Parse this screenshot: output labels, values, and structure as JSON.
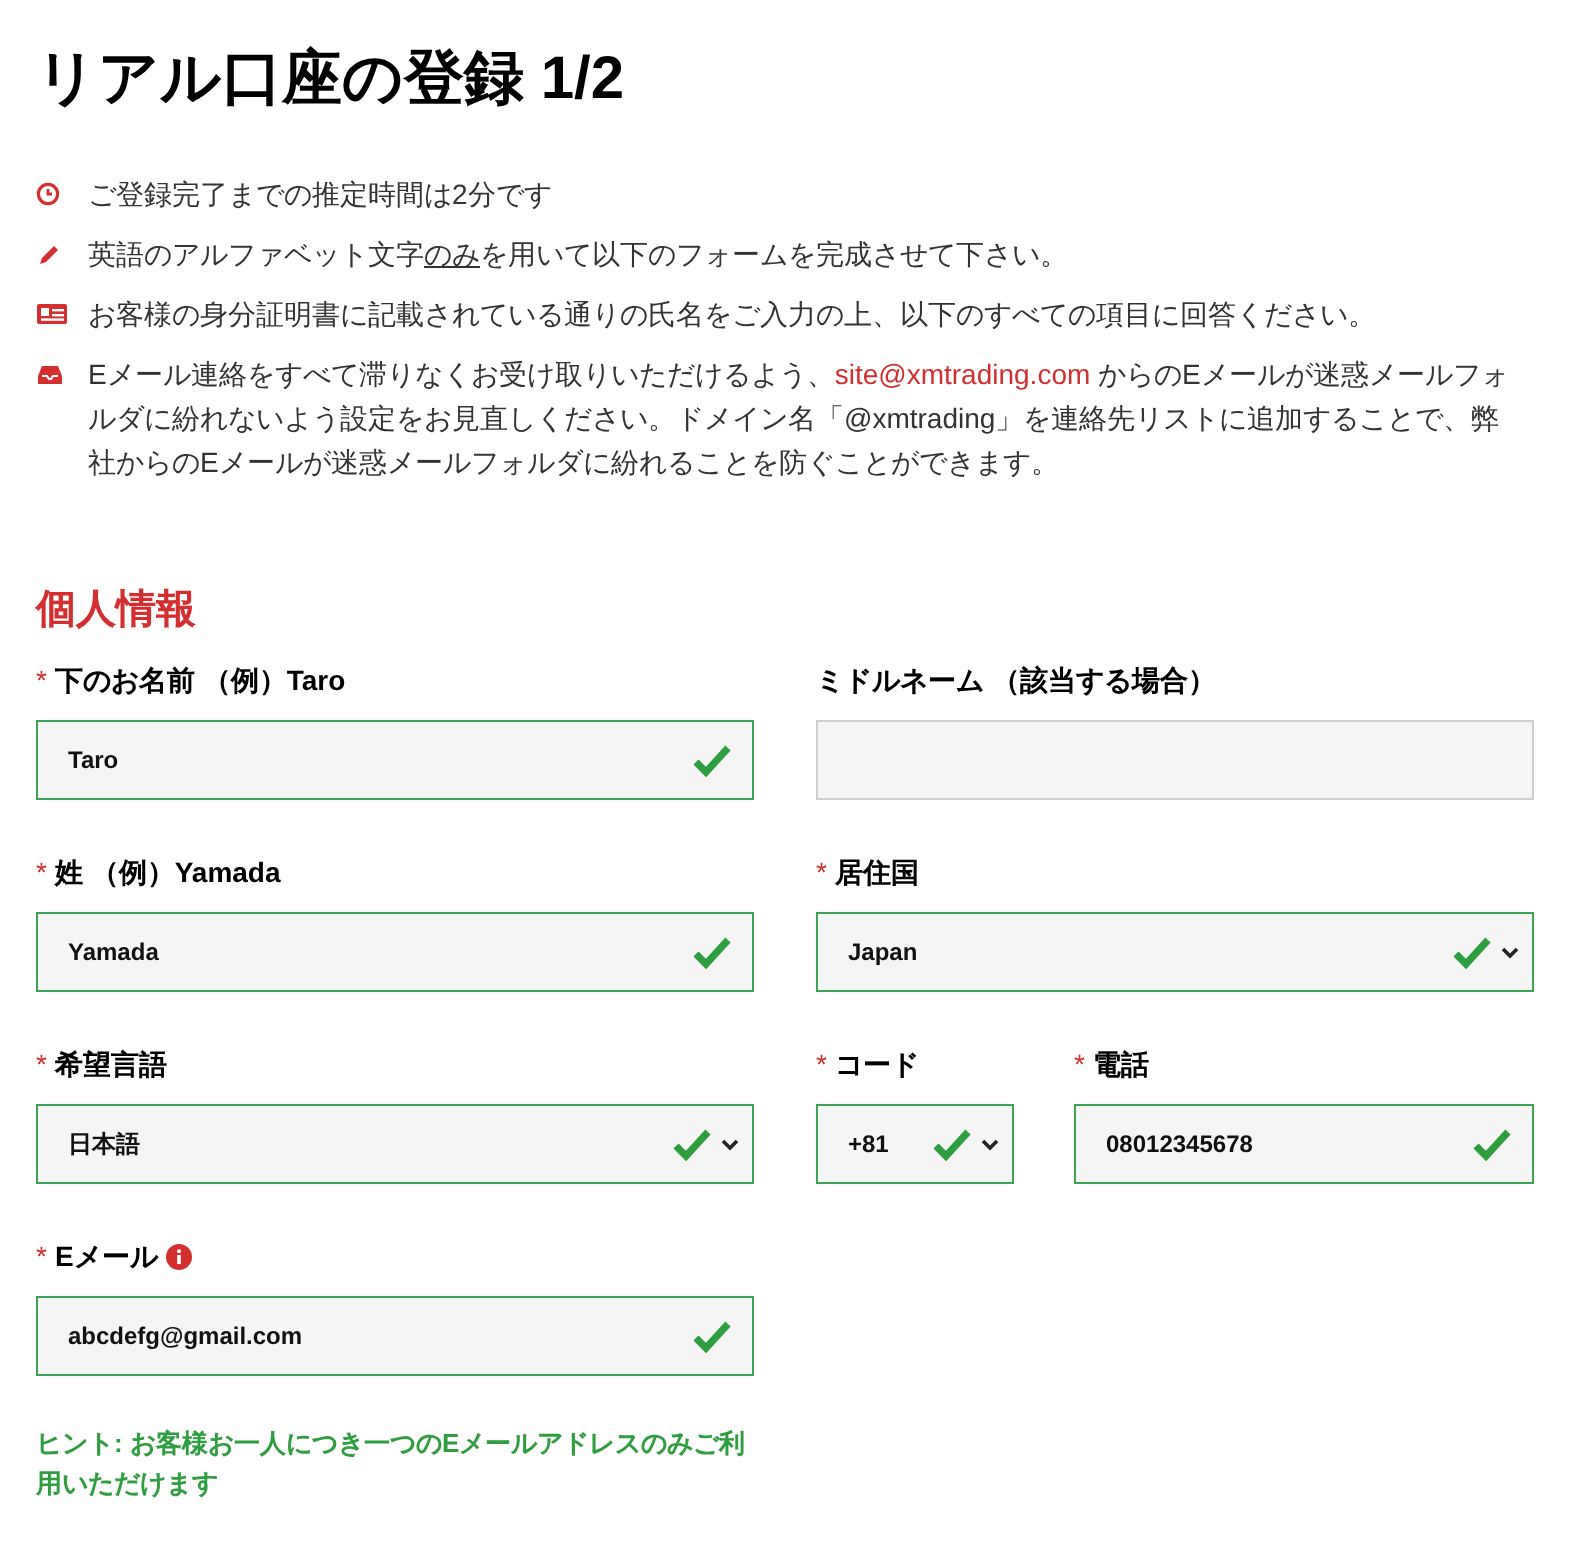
{
  "title": "リアル口座の登録 1/2",
  "notices": [
    {
      "kind": "clock",
      "parts": [
        {
          "kind": "plain",
          "text": "ご登録完了までの推定時間は2分です"
        }
      ]
    },
    {
      "kind": "pencil",
      "parts": [
        {
          "kind": "plain",
          "text": "英語のアルファベット文字"
        },
        {
          "kind": "underline",
          "text": "のみ"
        },
        {
          "kind": "plain",
          "text": "を用いて以下のフォームを完成させて下さい。"
        }
      ]
    },
    {
      "kind": "idcard",
      "parts": [
        {
          "kind": "plain",
          "text": "お客様の身分証明書に記載されている通りの氏名をご入力の上、以下のすべての項目に回答ください。"
        }
      ]
    },
    {
      "kind": "inbox",
      "parts": [
        {
          "kind": "plain",
          "text": "Eメール連絡をすべて滞りなくお受け取りいただけるよう、"
        },
        {
          "kind": "link",
          "text": "site@xmtrading.com"
        },
        {
          "kind": "plain",
          "text": " からのEメールが迷惑メールフォルダに紛れないよう設定をお見直しください。ドメイン名「@xmtrading」を連絡先リストに追加することで、弊社からのEメールが迷惑メールフォルダに紛れることを防ぐことができます。"
        }
      ]
    }
  ],
  "section": {
    "title": "個人情報",
    "rows": [
      {
        "columns": [
          {
            "field": {
              "label": "下のお名前 （例）Taro",
              "required_mark": "*",
              "kind": "text",
              "value": "Taro",
              "valid": true
            }
          },
          {
            "field": {
              "label": "ミドルネーム （該当する場合）",
              "kind": "text",
              "valid": false
            }
          }
        ]
      },
      {
        "columns": [
          {
            "field": {
              "label": "姓 （例）Yamada",
              "required_mark": "*",
              "kind": "text",
              "value": "Yamada",
              "valid": true
            }
          },
          {
            "field": {
              "label": "居住国",
              "required_mark": "*",
              "kind": "select",
              "value": "Japan",
              "valid": true
            }
          }
        ]
      },
      {
        "columns": [
          {
            "field": {
              "label": "希望言語",
              "required_mark": "*",
              "kind": "select",
              "value": "日本語",
              "valid": true
            }
          },
          {
            "fields": [
              {
                "label": "コード",
                "required_mark": "*",
                "kind": "select",
                "value": "+81",
                "valid": true
              },
              {
                "label": "電話",
                "required_mark": "*",
                "kind": "text",
                "value": "08012345678",
                "valid": true
              }
            ]
          }
        ]
      },
      {
        "columns": [
          {
            "field": {
              "label": "Eメール",
              "required_mark": "*",
              "info": true,
              "kind": "text",
              "value": "abcdefg@gmail.com",
              "valid": true
            }
          }
        ]
      }
    ],
    "hint": "ヒント: お客様お一人につき一つのEメールアドレスのみご利用いただけます"
  }
}
